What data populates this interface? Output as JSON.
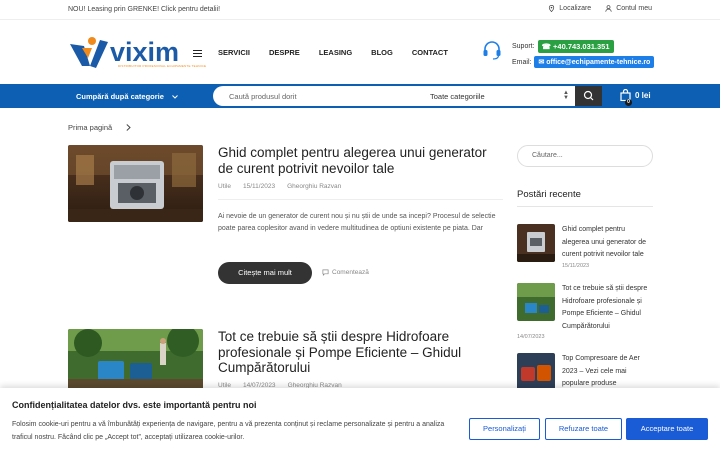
{
  "topbar": {
    "promo": "NOU! Leasing prin GRENKE! Click pentru detalii!",
    "location": "Localizare",
    "account": "Contul meu"
  },
  "brand": {
    "name": "vixim",
    "tagline": "DISTRIBUITOR PROFESIONAL ECHIPAMENTE TEHNICE",
    "primary_color": "#1b5aa6",
    "accent_color": "#f08a1c"
  },
  "nav": [
    "SERVICII",
    "DESPRE",
    "LEASING",
    "BLOG",
    "CONTACT"
  ],
  "support": {
    "phone_label": "Suport:",
    "phone": "+40.743.031.351",
    "email_label": "Email:",
    "email": "office@echipamente-tehnice.ro"
  },
  "bar": {
    "category_button": "Cumpără după categorie",
    "search_placeholder": "Caută produsul dorit",
    "category_select": "Toate categoriile",
    "cart_total": "0 lei",
    "cart_count": "0"
  },
  "breadcrumb": {
    "home": "Prima pagină"
  },
  "posts": [
    {
      "title": "Ghid complet pentru alegerea unui generator de curent potrivit nevoilor tale",
      "category": "Utile",
      "date": "15/11/2023",
      "author": "Gheorghiu Razvan",
      "excerpt": "Ai nevoie de un generator de curent nou și nu știi de unde sa incepi? Procesul de selectie poate parea coplesitor avand in vedere multitudinea de optiuni existente pe piata. Dar",
      "read_more": "Citește mai mult",
      "comment": "Comentează"
    },
    {
      "title": "Tot ce trebuie să știi despre Hidrofoare profesionale și Pompe Eficiente – Ghidul Cumpărătorului",
      "category": "Utile",
      "date": "14/07/2023",
      "author": "Gheorghiu Razvan"
    }
  ],
  "sidebar": {
    "search_placeholder": "Căutare...",
    "recent_title": "Postări recente",
    "recent": [
      {
        "title": "Ghid complet pentru alegerea unui generator de curent potrivit nevoilor tale",
        "date": "15/11/2023"
      },
      {
        "title": "Tot ce trebuie să știi despre Hidrofoare profesionale și Pompe Eficiente – Ghidul Cumpărătorului",
        "date": "14/07/2023"
      },
      {
        "title": "Top Compresoare de Aer 2023 – Vezi cele mai populare produse",
        "date": ""
      }
    ]
  },
  "cookie": {
    "title": "Confidențialitatea datelor dvs. este importantă pentru noi",
    "text": "Folosim cookie-uri pentru a vă îmbunătăți experiența de navigare, pentru a vă prezenta conținut și reclame personalizate și pentru a analiza traficul nostru. Făcând clic pe „Accept tot”, acceptați utilizarea cookie-urilor.",
    "customize": "Personalizați",
    "reject": "Refuzare toate",
    "accept": "Acceptare toate"
  }
}
